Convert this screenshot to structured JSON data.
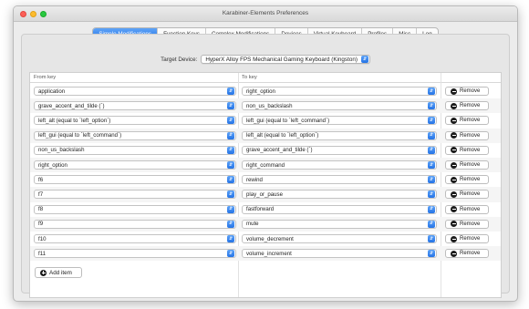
{
  "window": {
    "title": "Karabiner-Elements Preferences"
  },
  "tabs": [
    {
      "label": "Simple Modifications",
      "active": true
    },
    {
      "label": "Function Keys",
      "active": false
    },
    {
      "label": "Complex Modifications",
      "active": false
    },
    {
      "label": "Devices",
      "active": false
    },
    {
      "label": "Virtual Keyboard",
      "active": false
    },
    {
      "label": "Profiles",
      "active": false
    },
    {
      "label": "Misc",
      "active": false
    },
    {
      "label": "Log",
      "active": false
    }
  ],
  "target_device": {
    "label": "Target Device:",
    "value": "HyperX Alloy FPS Mechanical Gaming Keyboard (Kingston)"
  },
  "table": {
    "headers": {
      "from": "From key",
      "to": "To key"
    },
    "remove_label": "Remove",
    "rows": [
      {
        "from": "application",
        "to": "right_option"
      },
      {
        "from": "grave_accent_and_tilde (`)",
        "to": "non_us_backslash"
      },
      {
        "from": "left_alt (equal to `left_option`)",
        "to": "left_gui (equal to `left_command`)"
      },
      {
        "from": "left_gui (equal to `left_command`)",
        "to": "left_alt (equal to `left_option`)"
      },
      {
        "from": "non_us_backslash",
        "to": "grave_accent_and_tilde (`)"
      },
      {
        "from": "right_option",
        "to": "right_command"
      },
      {
        "from": "f6",
        "to": "rewind"
      },
      {
        "from": "f7",
        "to": "play_or_pause"
      },
      {
        "from": "f8",
        "to": "fastforward"
      },
      {
        "from": "f9",
        "to": "mute"
      },
      {
        "from": "f10",
        "to": "volume_decrement"
      },
      {
        "from": "f11",
        "to": "volume_increment"
      }
    ]
  },
  "add_item_label": "Add item",
  "colors": {
    "accent": "#2f7ff0",
    "close": "#fc5f57",
    "minimize": "#fdbc2e",
    "maximize": "#28c840"
  }
}
